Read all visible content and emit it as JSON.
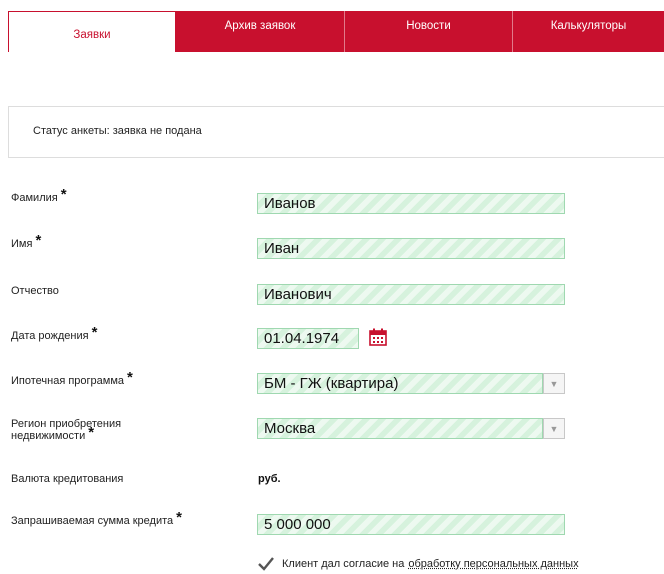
{
  "tabs": [
    {
      "label": "Заявки"
    },
    {
      "label": "Архив заявок"
    },
    {
      "label": "Новости"
    },
    {
      "label": "Калькуляторы"
    }
  ],
  "status": {
    "text": "Статус анкеты: заявка не подана"
  },
  "required_mark": "*",
  "form": {
    "surname": {
      "label": "Фамилия",
      "value": "Иванов"
    },
    "name": {
      "label": "Имя",
      "value": "Иван"
    },
    "patronymic": {
      "label": "Отчество",
      "value": "Иванович"
    },
    "birthdate": {
      "label": "Дата рождения",
      "value": "01.04.1974"
    },
    "program": {
      "label": "Ипотечная программа",
      "value": "БМ - ГЖ (квартира)"
    },
    "region": {
      "label_line1": "Регион приобретения",
      "label_line2": "недвижимости",
      "value": "Москва"
    },
    "currency": {
      "label": "Валюта кредитования",
      "value": "руб."
    },
    "amount": {
      "label": "Запрашиваемая сумма кредита",
      "value": "5 000 000"
    }
  },
  "consent": {
    "text": "Клиент дал согласие на",
    "link": "обработку персональных данных",
    "checked": true
  },
  "colors": {
    "accent": "#c8102e",
    "field_bg": "#d6f2dd",
    "field_border": "#9fd8b0"
  },
  "icons": {
    "calendar": "calendar-icon",
    "check": "checkmark-icon",
    "dropdown": "chevron-down-icon"
  }
}
